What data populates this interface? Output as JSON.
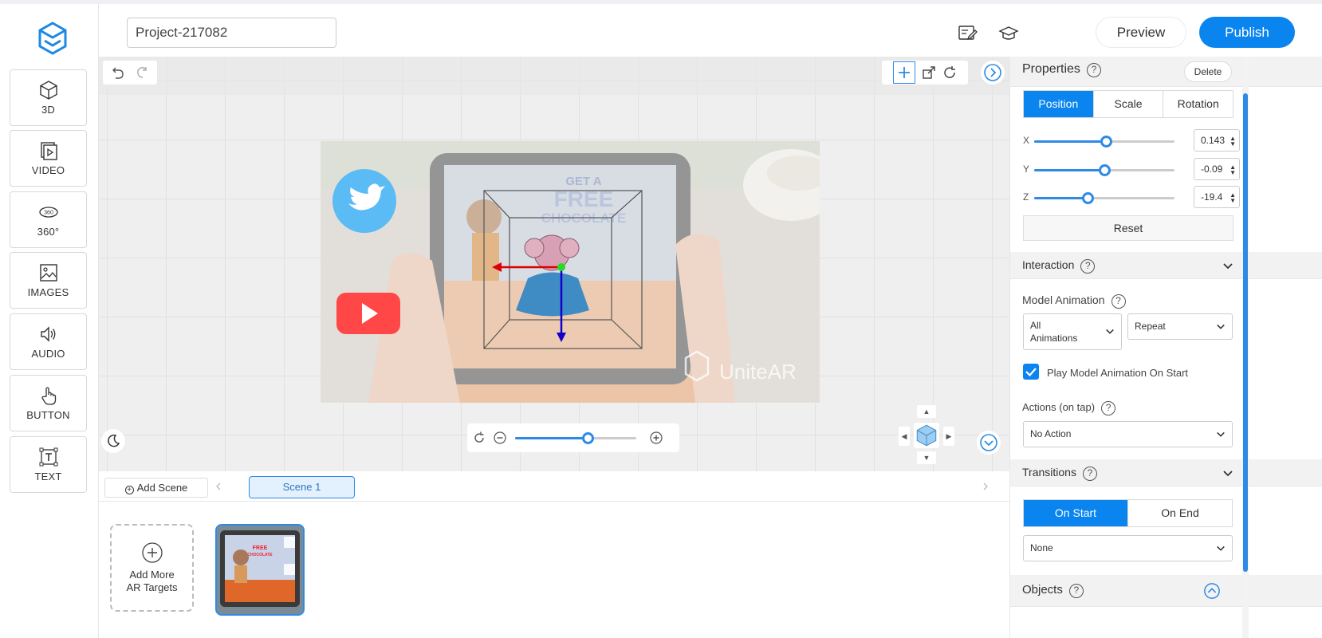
{
  "header": {
    "project_name": "Project-217082",
    "preview_label": "Preview",
    "publish_label": "Publish"
  },
  "sidebar": {
    "items": [
      {
        "label": "3D",
        "icon": "cube-icon"
      },
      {
        "label": "VIDEO",
        "icon": "video-icon"
      },
      {
        "label": "360°",
        "icon": "360-icon"
      },
      {
        "label": "IMAGES",
        "icon": "image-icon"
      },
      {
        "label": "AUDIO",
        "icon": "speaker-icon"
      },
      {
        "label": "BUTTON",
        "icon": "hand-pointer-icon"
      },
      {
        "label": "TEXT",
        "icon": "text-box-icon"
      }
    ]
  },
  "canvas": {
    "watermark": "UniteAR",
    "zoom_level": 0.6
  },
  "scenes": {
    "add_scene_label": "Add Scene",
    "tabs": [
      "Scene 1"
    ],
    "add_targets_label_line1": "Add More",
    "add_targets_label_line2": "AR Targets"
  },
  "properties": {
    "title": "Properties",
    "delete_label": "Delete",
    "tabs": [
      "Position",
      "Scale",
      "Rotation"
    ],
    "active_tab": "Position",
    "fields": [
      {
        "axis": "X",
        "value": "0.143",
        "level": 0.51
      },
      {
        "axis": "Y",
        "value": "-0.09",
        "level": 0.5
      },
      {
        "axis": "Z",
        "value": "-19.4",
        "level": 0.38
      }
    ],
    "reset_label": "Reset"
  },
  "interaction": {
    "title": "Interaction",
    "model_animation_label": "Model Animation",
    "animation_select_line1": "All",
    "animation_select_line2": "Animations",
    "repeat_select": "Repeat",
    "play_on_start_label": "Play Model Animation On Start",
    "play_on_start_checked": true,
    "actions_label": "Actions (on tap)",
    "actions_select": "No Action"
  },
  "transitions": {
    "title": "Transitions",
    "tabs": [
      "On Start",
      "On End"
    ],
    "active_tab": "On Start",
    "select": "None"
  },
  "objects": {
    "title": "Objects"
  },
  "colors": {
    "accent": "#0a84ef",
    "twitter": "#1da1f2",
    "youtube": "#ff0000"
  }
}
